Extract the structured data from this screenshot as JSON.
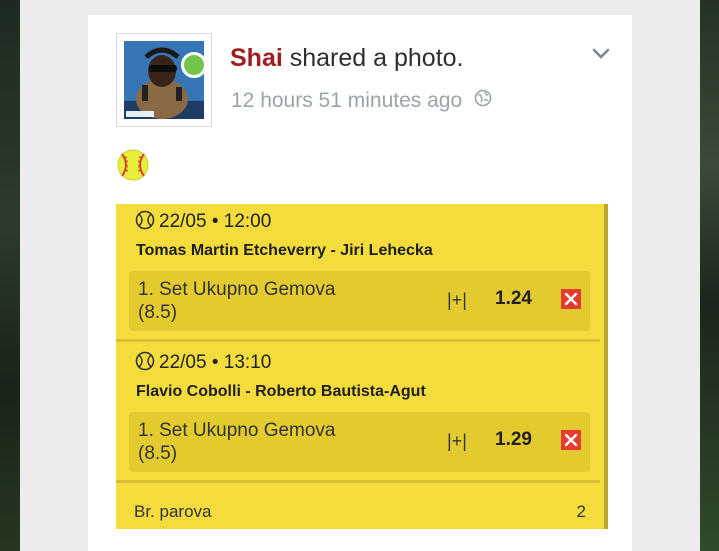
{
  "post": {
    "author": "Shai",
    "action": "shared a photo.",
    "timestamp": "12 hours 51 minutes ago",
    "privacy_icon": "globe-icon",
    "menu_icon": "chevron-down-icon",
    "online_status": "online",
    "emoji": "softball"
  },
  "ticket": {
    "matches": [
      {
        "date": "22/05",
        "time": "12:00",
        "players": "Tomas Martin Etcheverry - Jiri Lehecka",
        "market": "1. Set Ukupno Gemova",
        "line": "(8.5)",
        "pick": "|+|",
        "odds": "1.24",
        "status": "lost"
      },
      {
        "date": "22/05",
        "time": "13:10",
        "players": "Flavio Cobolli - Roberto Bautista-Agut",
        "market": "1. Set Ukupno Gemova",
        "line": "(8.5)",
        "pick": "|+|",
        "odds": "1.29",
        "status": "lost"
      }
    ],
    "summary_label": "Br. parova",
    "summary_value": "2"
  },
  "colors": {
    "ticket_bg": "#f3dc3c",
    "bet_bg": "#e3cb2f",
    "author": "#a11e1e",
    "status_lost": "#e63b2e",
    "online": "#74c44a"
  }
}
